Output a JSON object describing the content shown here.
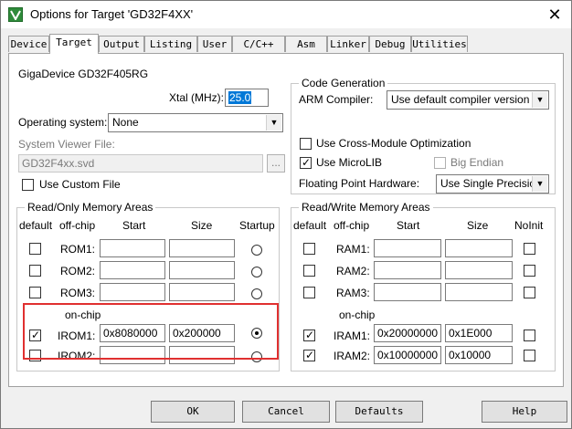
{
  "window": {
    "title": "Options for Target 'GD32F4XX'",
    "close_glyph": "✕"
  },
  "tabs": [
    {
      "label": "Device",
      "active": false
    },
    {
      "label": "Target",
      "active": true
    },
    {
      "label": "Output",
      "active": false
    },
    {
      "label": "Listing",
      "active": false
    },
    {
      "label": "User",
      "active": false
    },
    {
      "label": "C/C++",
      "active": false
    },
    {
      "label": "Asm",
      "active": false
    },
    {
      "label": "Linker",
      "active": false
    },
    {
      "label": "Debug",
      "active": false
    },
    {
      "label": "Utilities",
      "active": false
    }
  ],
  "target": {
    "device_name": "GigaDevice GD32F405RG",
    "xtal_label": "Xtal (MHz):",
    "xtal_value": "25.0",
    "os_label": "Operating system:",
    "os_value": "None",
    "svd_label": "System Viewer File:",
    "svd_value": "GD32F4xx.svd",
    "browse_glyph": "...",
    "custom_file_label": "Use Custom File"
  },
  "code_generation": {
    "title": "Code Generation",
    "compiler_label": "ARM Compiler:",
    "compiler_value": "Use default compiler version",
    "cross_module_label": "Use Cross-Module Optimization",
    "microlib_label": "Use MicroLIB",
    "big_endian_label": "Big Endian",
    "fpu_label": "Floating Point Hardware:",
    "fpu_value": "Use Single Precision"
  },
  "ro_memory": {
    "title": "Read/Only Memory Areas",
    "headers": {
      "default": "default",
      "offchip": "off-chip",
      "start": "Start",
      "size": "Size",
      "startup": "Startup"
    },
    "offchip_rows": [
      {
        "label": "ROM1:",
        "start": "",
        "size": ""
      },
      {
        "label": "ROM2:",
        "start": "",
        "size": ""
      },
      {
        "label": "ROM3:",
        "start": "",
        "size": ""
      }
    ],
    "onchip_label": "on-chip",
    "onchip_rows": [
      {
        "label": "IROM1:",
        "start": "0x8080000",
        "size": "0x200000"
      },
      {
        "label": "IROM2:",
        "start": "",
        "size": ""
      }
    ]
  },
  "rw_memory": {
    "title": "Read/Write Memory Areas",
    "headers": {
      "default": "default",
      "offchip": "off-chip",
      "start": "Start",
      "size": "Size",
      "noinit": "NoInit"
    },
    "offchip_rows": [
      {
        "label": "RAM1:",
        "start": "",
        "size": ""
      },
      {
        "label": "RAM2:",
        "start": "",
        "size": ""
      },
      {
        "label": "RAM3:",
        "start": "",
        "size": ""
      }
    ],
    "onchip_label": "on-chip",
    "onchip_rows": [
      {
        "label": "IRAM1:",
        "start": "0x20000000",
        "size": "0x1E000"
      },
      {
        "label": "IRAM2:",
        "start": "0x10000000",
        "size": "0x10000"
      }
    ]
  },
  "checks": {
    "mark": "✓"
  },
  "buttons": {
    "ok": "OK",
    "cancel": "Cancel",
    "defaults": "Defaults",
    "help": "Help"
  },
  "icons": {
    "app": "keil-uvision-icon",
    "dropdown": "chevron-down-icon",
    "close": "close-icon"
  },
  "colors": {
    "highlight": "#e03030",
    "selection": "#0078d7"
  }
}
